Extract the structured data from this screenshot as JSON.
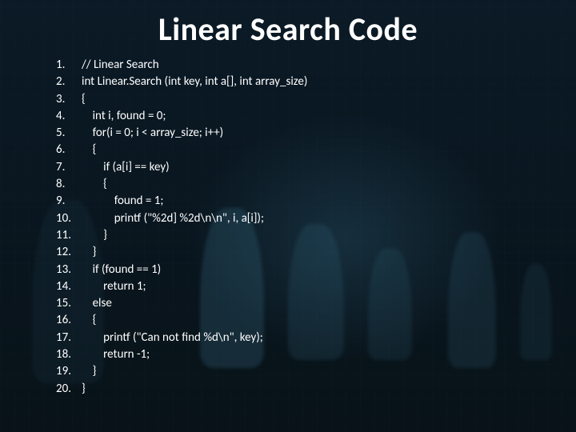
{
  "title": "Linear Search Code",
  "code": [
    {
      "n": "1.",
      "t": "// Linear Search"
    },
    {
      "n": "2.",
      "t": "int Linear.Search (int key, int a[], int array_size)"
    },
    {
      "n": "3.",
      "t": "{"
    },
    {
      "n": "4.",
      "t": "    int i, found = 0;"
    },
    {
      "n": "5.",
      "t": "    for(i = 0; i < array_size; i++)"
    },
    {
      "n": "6.",
      "t": "    {"
    },
    {
      "n": "7.",
      "t": "        if (a[i] == key)"
    },
    {
      "n": "8.",
      "t": "        {"
    },
    {
      "n": "9.",
      "t": "            found = 1;"
    },
    {
      "n": "10.",
      "t": "            printf (\"%2d] %2d\\n\\n\", i, a[i]);"
    },
    {
      "n": "11.",
      "t": "        }"
    },
    {
      "n": "12.",
      "t": "    }"
    },
    {
      "n": "13.",
      "t": "    if (found == 1)"
    },
    {
      "n": "14.",
      "t": "        return 1;"
    },
    {
      "n": "15.",
      "t": "    else"
    },
    {
      "n": "16.",
      "t": "    {"
    },
    {
      "n": "17.",
      "t": "        printf (\"Can not find %d\\n\", key);"
    },
    {
      "n": "18.",
      "t": "        return -1;"
    },
    {
      "n": "19.",
      "t": "    }"
    },
    {
      "n": "20.",
      "t": "}"
    }
  ]
}
